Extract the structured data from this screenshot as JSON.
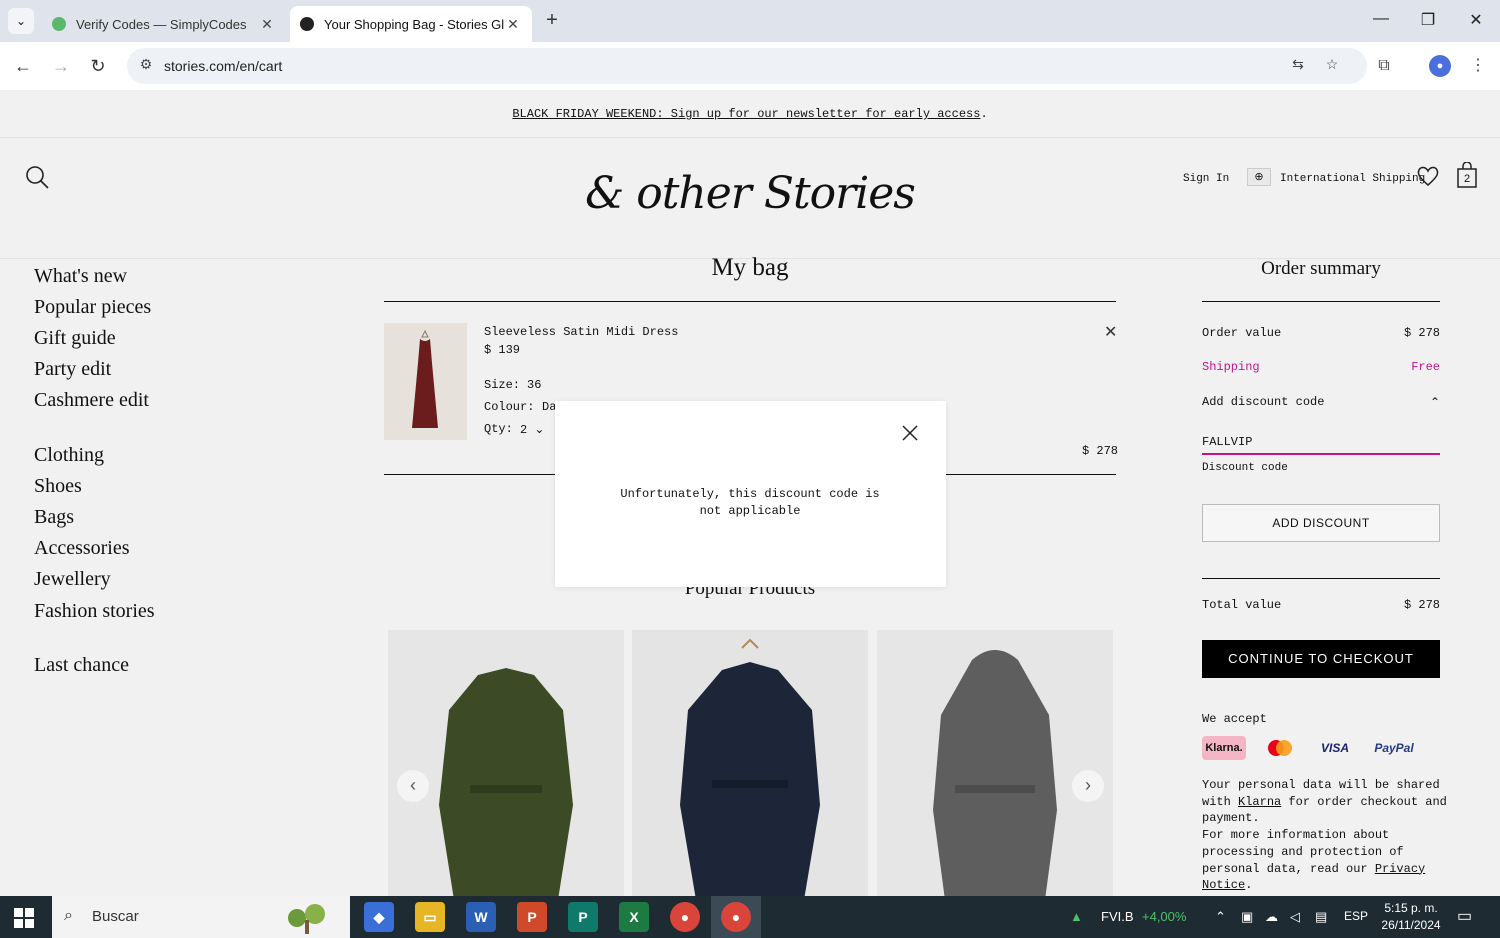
{
  "browser": {
    "tabs": [
      {
        "title": "Verify Codes — SimplyCodes",
        "active": false
      },
      {
        "title": "Your Shopping Bag - Stories Gl",
        "active": true
      }
    ],
    "url": "stories.com/en/cart"
  },
  "site": {
    "promo_text": "BLACK FRIDAY WEEKEND: Sign up for our newsletter for early access",
    "promo_suffix": ".",
    "logo": "& other Stories",
    "sign_in": "Sign In",
    "shipping_link": "International Shipping",
    "bag_count": "2"
  },
  "sidebar": {
    "group1": [
      "What's new",
      "Popular pieces",
      "Gift guide",
      "Party edit",
      "Cashmere edit"
    ],
    "group2": [
      "Clothing",
      "Shoes",
      "Bags",
      "Accessories",
      "Jewellery",
      "Fashion stories"
    ],
    "group3": [
      "Last chance"
    ]
  },
  "bag": {
    "title": "My bag",
    "item": {
      "name": "Sleeveless Satin Midi Dress",
      "price": "$ 139",
      "size_label": "Size:",
      "size_value": "36",
      "colour_label": "Colour:",
      "colour_value": "Da",
      "qty_label": "Qty:",
      "qty_value": "2",
      "line_total": "$ 278"
    }
  },
  "popular": {
    "title": "Popular Products"
  },
  "summary": {
    "title": "Order summary",
    "order_value_label": "Order value",
    "order_value": "$ 278",
    "shipping_label": "Shipping",
    "shipping_value": "Free",
    "discount_toggle": "Add discount code",
    "discount_input_value": "FALLVIP",
    "discount_input_label": "Discount code",
    "add_discount_button": "ADD DISCOUNT",
    "total_label": "Total value",
    "total_value": "$ 278",
    "checkout_button": "CONTINUE TO CHECKOUT",
    "we_accept": "We accept",
    "payment_methods": [
      "Klarna.",
      "VISA",
      "PayPal"
    ],
    "info_p1_a": "Your personal data will be shared with ",
    "info_link1": "Klarna",
    "info_p1_b": " for order checkout and payment.",
    "info_p2_a": "For more information about processing and protection of personal data, read our ",
    "info_link2": "Privacy Notice",
    "info_p2_b": "."
  },
  "modal": {
    "message": "Unfortunately, this discount code is not applicable"
  },
  "taskbar": {
    "search_placeholder": "Buscar",
    "stock_name": "FVI.B",
    "stock_change": "+4,00%",
    "language": "ESP",
    "time": "5:15 p. m.",
    "date": "26/11/2024"
  },
  "colors": {
    "accent_pink": "#c2148a",
    "klarna_pink": "#f4b6c7",
    "stock_green": "#4cc26a"
  }
}
